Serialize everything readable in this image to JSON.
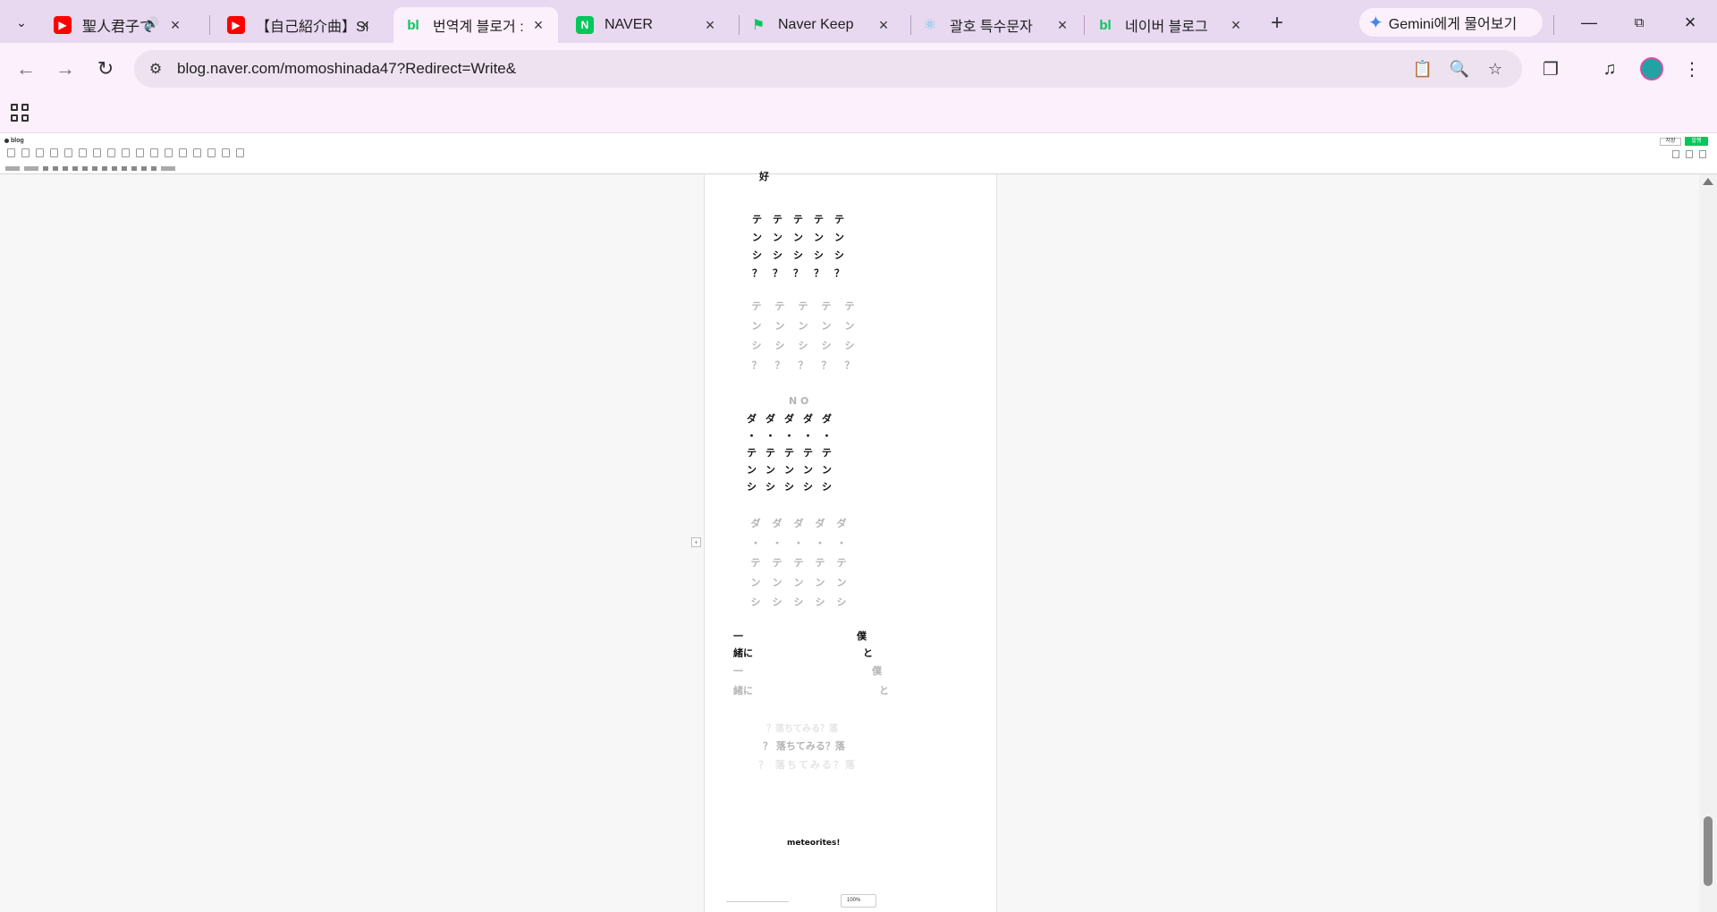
{
  "browser": {
    "tabs": [
      {
        "title": "聖人君子で",
        "favicon": "youtube-icon",
        "audio": true
      },
      {
        "title": "【自己紹介曲】SE",
        "favicon": "youtube-icon"
      },
      {
        "title": "번역계 블로거 :",
        "favicon": "naver-blog-icon",
        "active": true
      },
      {
        "title": "NAVER",
        "favicon": "naver-icon"
      },
      {
        "title": "Naver Keep",
        "favicon": "naver-keep-icon"
      },
      {
        "title": "괄호 특수문자",
        "favicon": "react-icon"
      },
      {
        "title": "네이버 블로그",
        "favicon": "naver-blog-icon"
      }
    ],
    "gemini_button": "Gemini에게 물어보기",
    "url": "blog.naver.com/momoshinada47?Redirect=Write&"
  },
  "editor": {
    "logo": "blog",
    "save_label": "저장",
    "publish_label": "발행",
    "content": {
      "top_fragment": "好",
      "block1_rows": [
        "テ",
        "ン",
        "シ",
        "？"
      ],
      "no_label": "N O",
      "block2_rows": [
        "ダ",
        "・",
        "テ",
        "ン",
        "シ"
      ],
      "pair_lines": {
        "left": [
          "一",
          "緒に"
        ],
        "right": [
          "僕",
          "と"
        ]
      },
      "falling_lines": [
        "？落ちてみる？落",
        "？ 落ちてみる？落",
        "？ 落ちてみる？落"
      ],
      "ending": "meteorites!"
    }
  },
  "colors": {
    "tabstrip": "#e8d8f0",
    "toolbar": "#fbf0fb",
    "publish_green": "#03c75a",
    "faded_text": "#b4b4b4"
  }
}
